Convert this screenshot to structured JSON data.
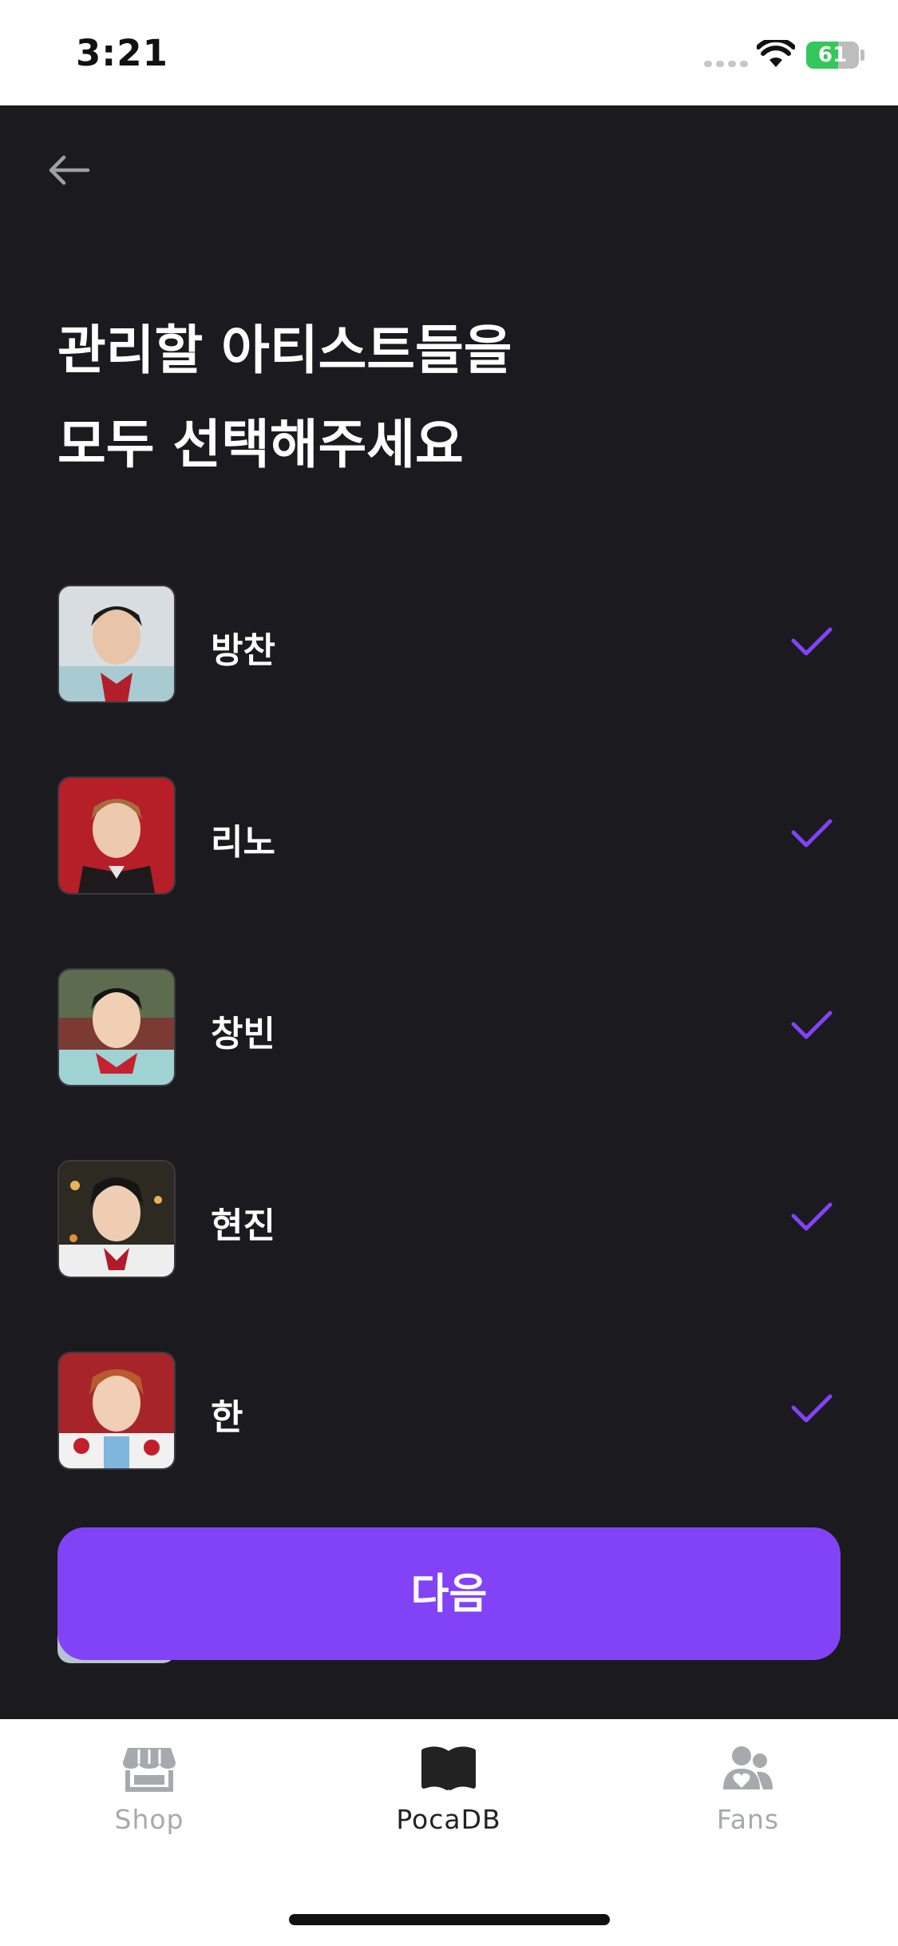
{
  "status_bar": {
    "time": "3:21",
    "battery_level": "61",
    "battery_fraction": 0.61
  },
  "heading": {
    "line1": "관리할 아티스트들을",
    "line2": "모두 선택해주세요"
  },
  "artists": [
    {
      "name": "방찬",
      "selected": true
    },
    {
      "name": "리노",
      "selected": true
    },
    {
      "name": "창빈",
      "selected": true
    },
    {
      "name": "현진",
      "selected": true
    },
    {
      "name": "한",
      "selected": true
    }
  ],
  "next_button": {
    "label": "다음"
  },
  "tab_bar": {
    "tabs": [
      {
        "label": "Shop",
        "icon": "shop-icon",
        "active": false
      },
      {
        "label": "PocaDB",
        "icon": "book-icon",
        "active": true
      },
      {
        "label": "Fans",
        "icon": "fans-icon",
        "active": false
      }
    ]
  },
  "colors": {
    "background": "#1b1a1f",
    "accent": "#8243f7",
    "check": "#8243f7",
    "battery": "#34c759"
  }
}
